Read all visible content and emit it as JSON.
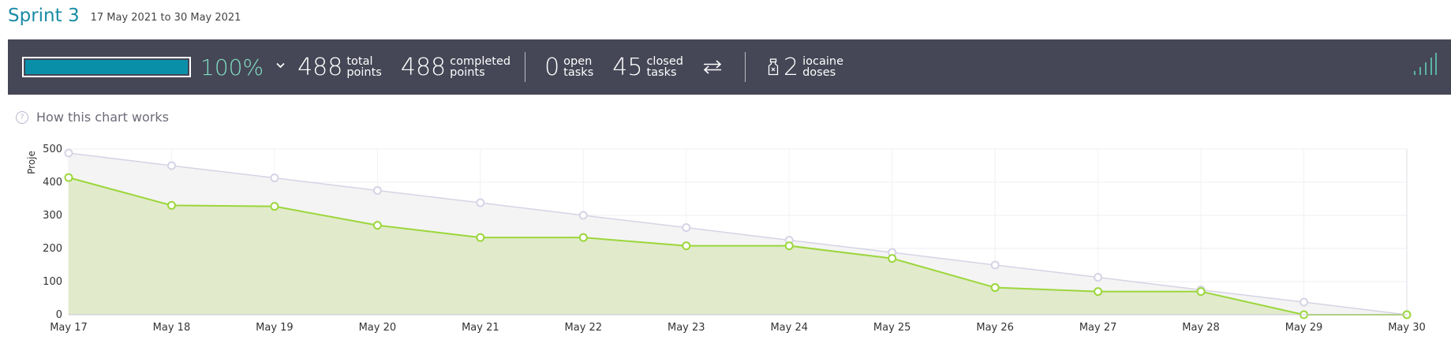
{
  "sprint": {
    "title": "Sprint 3",
    "dates": "17 May 2021 to 30 May 2021"
  },
  "stats": {
    "progress_fraction": 1.0,
    "percent": "100%",
    "total": {
      "value": "488",
      "label1": "total",
      "label2": "points"
    },
    "completed": {
      "value": "488",
      "label1": "completed",
      "label2": "points"
    },
    "open": {
      "value": "0",
      "label1": "open",
      "label2": "tasks"
    },
    "closed": {
      "value": "45",
      "label1": "closed",
      "label2": "tasks"
    },
    "iocaine": {
      "value": "2",
      "label1": "iocaine",
      "label2": "doses"
    }
  },
  "help_link": "How this chart works",
  "colors": {
    "accent": "#1a8ba6",
    "bar_bg": "#454656",
    "progress": "#0a8fa8",
    "percent": "#80dcc1",
    "actual_line": "#9bd63a",
    "actual_fill": "#dfe9c5",
    "optimal_line": "#d4d4e6",
    "optimal_fill": "#f3f3f3"
  },
  "chart_data": {
    "type": "area",
    "ylabel": "Proje",
    "ylim": [
      0,
      500
    ],
    "yticks": [
      0,
      100,
      200,
      300,
      400,
      500
    ],
    "categories": [
      "May 17",
      "May 18",
      "May 19",
      "May 20",
      "May 21",
      "May 22",
      "May 23",
      "May 24",
      "May 25",
      "May 26",
      "May 27",
      "May 28",
      "May 29",
      "May 30"
    ],
    "series": [
      {
        "values": [
          488,
          450,
          413,
          375,
          338,
          300,
          263,
          225,
          188,
          150,
          113,
          75,
          38,
          0
        ]
      },
      {
        "values": [
          414,
          330,
          327,
          270,
          233,
          233,
          208,
          208,
          170,
          82,
          70,
          70,
          0,
          0
        ]
      }
    ],
    "grid": true
  }
}
